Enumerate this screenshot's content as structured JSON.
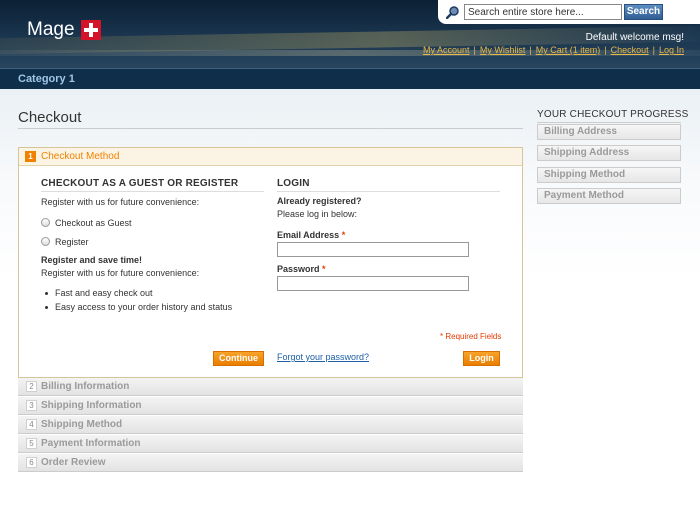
{
  "header": {
    "logo_text": "Mage",
    "search_placeholder": "Search entire store here...",
    "search_button": "Search",
    "welcome": "Default welcome msg!",
    "links": [
      "My Account",
      "My Wishlist",
      "My Cart (1 item)",
      "Checkout",
      "Log In"
    ]
  },
  "nav": {
    "items": [
      "Category 1"
    ]
  },
  "page": {
    "title": "Checkout"
  },
  "checkout": {
    "active_step": {
      "number": "1",
      "title": "Checkout Method"
    },
    "guest": {
      "heading": "Checkout as a Guest or Register",
      "intro": "Register with us for future convenience:",
      "options": [
        "Checkout as Guest",
        "Register"
      ],
      "save_heading": "Register and save time!",
      "save_text": "Register with us for future convenience:",
      "benefits": [
        "Fast and easy check out",
        "Easy access to your order history and status"
      ],
      "continue_button": "Continue"
    },
    "login": {
      "heading": "Login",
      "already": "Already registered?",
      "please": "Please log in below:",
      "email_label": "Email Address",
      "password_label": "Password",
      "required_mark": "*",
      "required_note": "* Required Fields",
      "forgot": "Forgot your password?",
      "login_button": "Login"
    },
    "steps": [
      {
        "number": "2",
        "title": "Billing Information"
      },
      {
        "number": "3",
        "title": "Shipping Information"
      },
      {
        "number": "4",
        "title": "Shipping Method"
      },
      {
        "number": "5",
        "title": "Payment Information"
      },
      {
        "number": "6",
        "title": "Order Review"
      }
    ]
  },
  "progress": {
    "title": "Your Checkout Progress",
    "items": [
      "Billing Address",
      "Shipping Address",
      "Shipping Method",
      "Payment Method"
    ]
  }
}
